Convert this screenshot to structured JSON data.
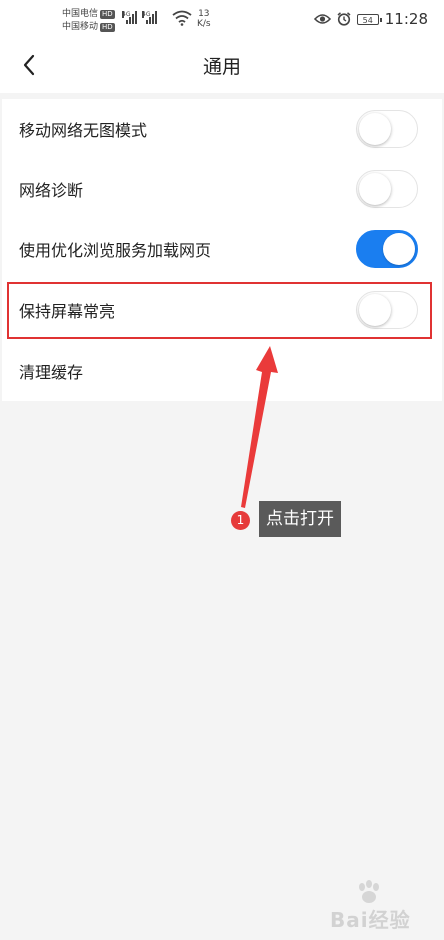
{
  "status_bar": {
    "carrier_1": "中国电信",
    "carrier_2": "中国移动",
    "hd_badge": "HD",
    "network_1": "4G",
    "network_2": "4G",
    "speed_value": "13",
    "speed_unit": "K/s",
    "battery": "54",
    "time": "11:28"
  },
  "header": {
    "back_icon": "chevron-left-icon",
    "title": "通用"
  },
  "settings": [
    {
      "label": "移动网络无图模式",
      "toggle": false
    },
    {
      "label": "网络诊断",
      "toggle": false
    },
    {
      "label": "使用优化浏览服务加载网页",
      "toggle": true
    },
    {
      "label": "保持屏幕常亮",
      "toggle": false
    },
    {
      "label": "清理缓存"
    }
  ],
  "annotation": {
    "step_number": "1",
    "callout_text": "点击打开",
    "highlight_color": "#e03232",
    "badge_color": "#e63a3a"
  },
  "colors": {
    "toggle_on": "#1a7ef0",
    "toggle_off_border": "#e4e4e4",
    "page_background": "#f4f4f4"
  },
  "watermark": {
    "logo_text": "Bai",
    "logo_suffix": "经验"
  }
}
